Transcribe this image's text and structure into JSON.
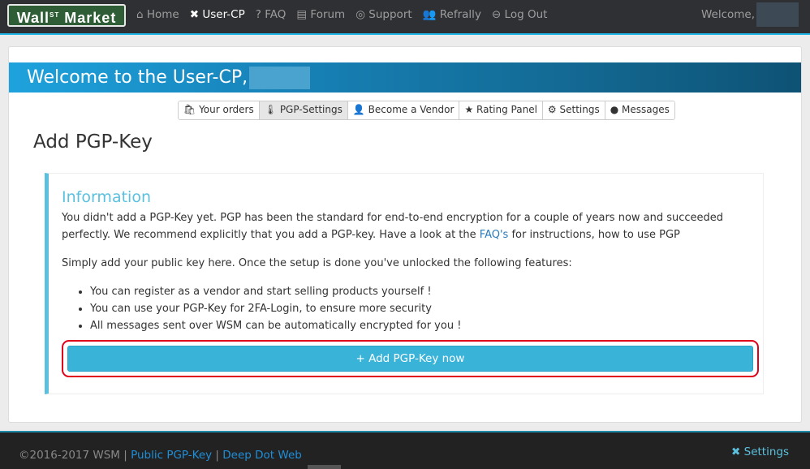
{
  "nav": {
    "logo": "Wall",
    "logo_sup": "ST",
    "logo_rest": "Market",
    "items": [
      {
        "icon": "⌂",
        "label": "Home"
      },
      {
        "icon": "✖",
        "label": "User-CP"
      },
      {
        "icon": "?",
        "label": "FAQ"
      },
      {
        "icon": "▤",
        "label": "Forum"
      },
      {
        "icon": "◎",
        "label": "Support"
      },
      {
        "icon": "👥",
        "label": "Refrally"
      },
      {
        "icon": "⊖",
        "label": "Log Out"
      }
    ],
    "welcome": "Welcome,"
  },
  "banner": {
    "title": "Welcome to the User-CP,"
  },
  "tabs": [
    {
      "icon": "🛍",
      "label": "Your orders"
    },
    {
      "icon": "🌡",
      "label": "PGP-Settings"
    },
    {
      "icon": "👤",
      "label": "Become a Vendor"
    },
    {
      "icon": "★",
      "label": "Rating Panel"
    },
    {
      "icon": "⚙",
      "label": "Settings"
    },
    {
      "icon": "●",
      "label": "Messages"
    }
  ],
  "page_title": "Add PGP-Key",
  "info": {
    "title": "Information",
    "p1_before": "You didn't add a PGP-Key yet. PGP has been the standard for end-to-end encryption for a couple of years now and succeeded perfectly. We recommend explicitly that you add a PGP-key. Have a look at the ",
    "p1_link": "FAQ's",
    "p1_after": " for instructions, how to use PGP",
    "p2": "Simply add your public key here. Once the setup is done you've unlocked the following features:",
    "features": [
      "You can register as a vendor and start selling products yourself !",
      "You can use your PGP-Key for 2FA-Login, to ensure more security",
      "All messages sent over WSM can be automatically encrypted for you !"
    ],
    "button": "+ Add PGP-Key now"
  },
  "footer": {
    "copyright": "©2016-2017 WSM |",
    "link1": "Public PGP-Key",
    "sep": "|",
    "link2": "Deep Dot Web",
    "settings": "✖ Settings"
  }
}
